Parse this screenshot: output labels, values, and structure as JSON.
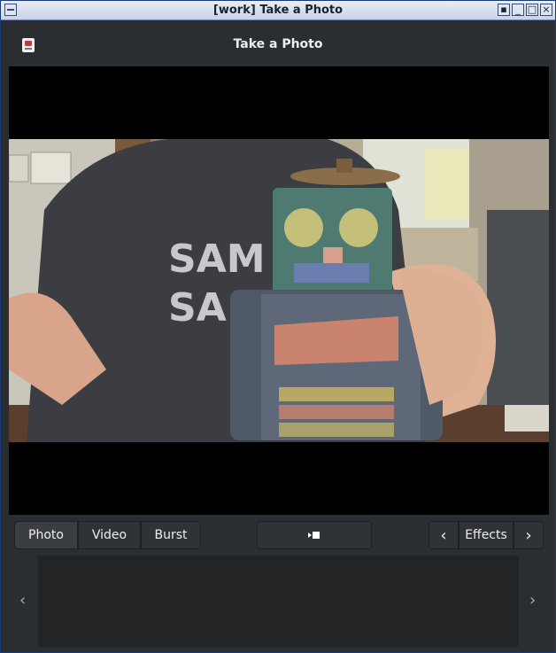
{
  "window": {
    "wm_title": "[work] Take a Photo",
    "header_title": "Take a Photo",
    "app_icon": "camera-app-icon"
  },
  "modes": {
    "photo": "Photo",
    "video": "Video",
    "burst": "Burst",
    "active": "Photo"
  },
  "capture": {
    "icon": "record-video-icon"
  },
  "effects": {
    "label": "Effects",
    "prev_icon": "chevron-left-icon",
    "next_icon": "chevron-right-icon"
  },
  "strip": {
    "prev_icon": "chevron-left-icon",
    "next_icon": "chevron-right-icon"
  },
  "preview": {
    "shirt_text_line1": "SAM",
    "shirt_text_line2": "SA"
  }
}
